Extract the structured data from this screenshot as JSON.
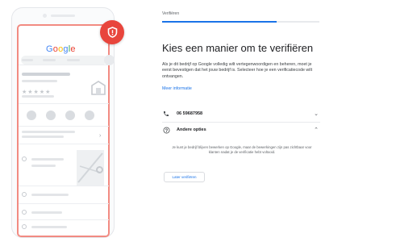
{
  "phone": {
    "logo": [
      "G",
      "o",
      "o",
      "g",
      "l",
      "e"
    ],
    "stars": "★★★★★"
  },
  "header": {
    "step_label": "Verifiëren",
    "progress": 0.73
  },
  "main": {
    "title": "Kies een manier om te verifiëren",
    "description": "Als je dit bedrijf op Google volledig wilt vertegenwoordigen en beheren, moet je eerst bevestigen dat het jouw bedrijf is. Selecteer hoe je een verificatiecode wilt ontvangen.",
    "more_info_link": "Meer informatie",
    "phone_option": {
      "number": "06 59687958",
      "icon": "phone-icon",
      "chevron": "⌄"
    },
    "other_options": {
      "label": "Andere opties",
      "icon": "help-circle-icon",
      "chevron": "⌃"
    },
    "note": "Je kunt je bedrijf blijven bewerken op Google, maar de bewerkingen zijn pas zichtbaar voor klanten nadat je de verificatie hebt voltooid.",
    "later_button": "Later verifiëren"
  },
  "colors": {
    "accent": "#1a73e8",
    "badge": "#e8453c",
    "screen_border": "#f28b82"
  }
}
